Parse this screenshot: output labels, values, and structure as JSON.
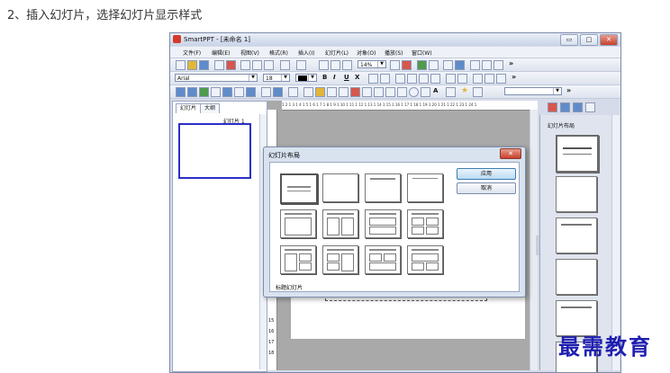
{
  "caption": "2、插入幻灯片，选择幻灯片显示样式",
  "window": {
    "title": "SmartPPT - [未命名 1]",
    "min": "▭",
    "max": "□",
    "close": "✕"
  },
  "menu": [
    "文件(F)",
    "编辑(E)",
    "视图(V)",
    "格式(R)",
    "插入(I)",
    "幻灯片(L)",
    "对象(O)",
    "播放(S)",
    "窗口(W)"
  ],
  "toolbar1": {
    "zoom": "14%",
    "overflow": "»"
  },
  "toolbar2": {
    "font": "Arial",
    "size": "18",
    "bold": "B",
    "italic": "I",
    "underline": "U",
    "strike": "X",
    "overflow": "»"
  },
  "toolbar3": {
    "text_tool": "A",
    "overflow": "»"
  },
  "left_pane": {
    "tabs": [
      "幻灯片",
      "大纲"
    ],
    "slide_label": "幻灯片 1"
  },
  "editor": {
    "ruler_h": "1 2 1 3 1 4 1 5 1 6 1 7 1 8 1 9 1 10 1 11 1 12 1 13 1 14 1 15 1 16 1 17 1 18 1 19 1 20 1 21 1 22 1 23 1 24 1",
    "ruler_v": [
      "15",
      "16",
      "17",
      "18"
    ]
  },
  "layout_panel": {
    "title": "幻灯片布局"
  },
  "dialog": {
    "title": "幻灯片布局",
    "close": "✕",
    "apply": "应用",
    "cancel": "取消",
    "selected_layout": "标题幻灯片"
  },
  "watermark": "最需教育"
}
